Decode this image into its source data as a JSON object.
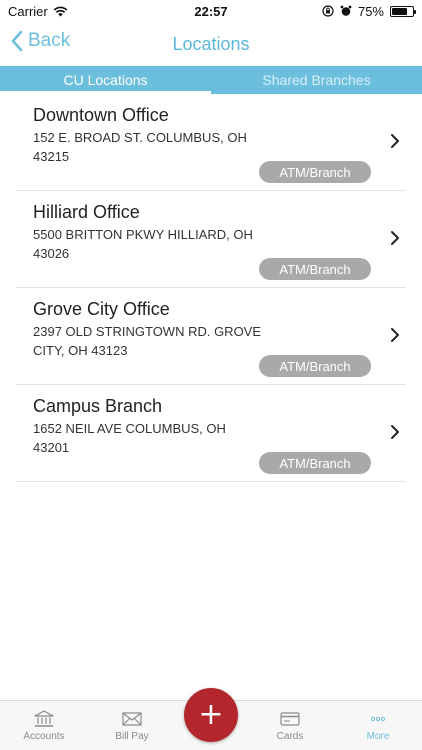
{
  "status_bar": {
    "carrier": "Carrier",
    "time": "22:57",
    "battery": "75%",
    "battery_level": 0.75
  },
  "nav": {
    "back_label": "Back",
    "title": "Locations"
  },
  "tabs": [
    {
      "label": "CU Locations",
      "active": true
    },
    {
      "label": "Shared Branches",
      "active": false
    }
  ],
  "locations": [
    {
      "name": "Downtown Office",
      "address": "152 E. BROAD ST. COLUMBUS, OH 43215",
      "type": "ATM/Branch"
    },
    {
      "name": "Hilliard Office",
      "address": "5500 BRITTON PKWY HILLIARD, OH 43026",
      "type": "ATM/Branch"
    },
    {
      "name": "Grove City Office",
      "address": "2397 OLD STRINGTOWN RD. GROVE CITY, OH 43123",
      "type": "ATM/Branch"
    },
    {
      "name": "Campus Branch",
      "address": "1652 NEIL AVE COLUMBUS, OH 43201",
      "type": "ATM/Branch"
    }
  ],
  "tabbar": {
    "accounts": "Accounts",
    "bill_pay": "Bill Pay",
    "add": "+",
    "cards": "Cards",
    "more": "More"
  },
  "colors": {
    "accent": "#6cbfdc",
    "fab": "#b3262c",
    "badge": "#a9a9a9"
  },
  "icons": {
    "wifi": "wifi-icon",
    "lock": "orientation-lock-icon",
    "alarm": "alarm-icon",
    "battery": "battery-icon",
    "back": "chevron-left-icon",
    "row": "chevron-right-icon",
    "accounts": "bank-icon",
    "bill_pay": "envelope-icon",
    "add": "plus-icon",
    "cards": "card-icon",
    "more": "ellipsis-icon"
  }
}
